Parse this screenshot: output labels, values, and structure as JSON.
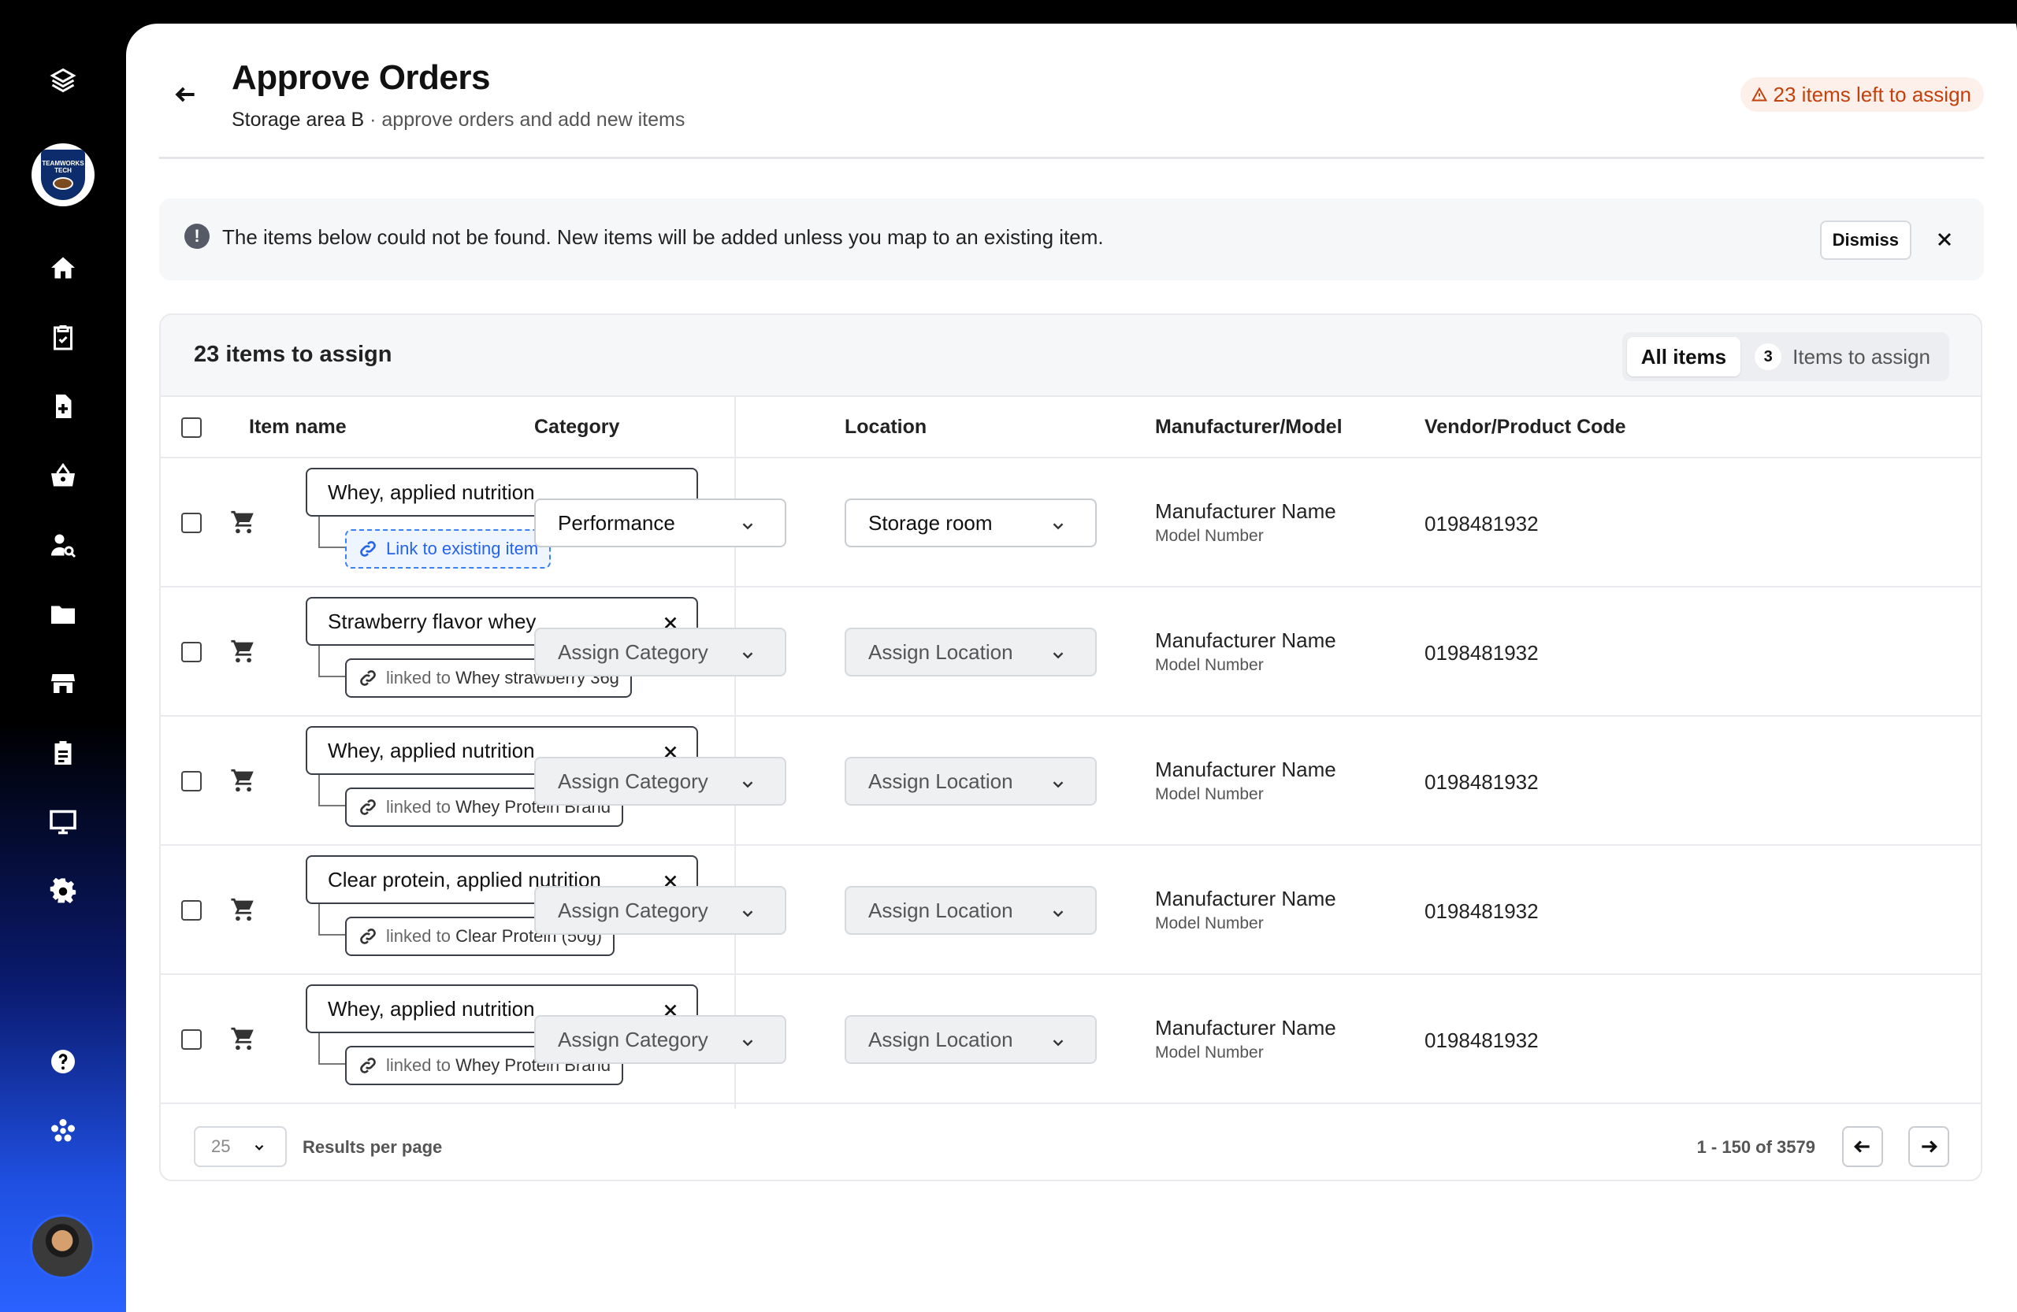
{
  "sidebar": {
    "icons": [
      "layers-logo-icon",
      "home-icon",
      "clipboard-check-icon",
      "file-add-icon",
      "basket-icon",
      "user-search-icon",
      "folder-icon",
      "store-icon",
      "clipboard-list-icon",
      "monitor-icon",
      "gear-icon",
      "help-icon",
      "apps-icon"
    ],
    "team_badge_text": "TEAMWORKS TECH"
  },
  "header": {
    "title": "Approve Orders",
    "subtitle_area": "Storage area B",
    "subtitle_sep": " · ",
    "subtitle_desc": "approve orders and add new items",
    "warning": "23 items left to assign"
  },
  "alert": {
    "message": "The items below could not be found. New items will be added unless you map to an existing item.",
    "dismiss_label": "Dismiss"
  },
  "card": {
    "title": "23 items to assign",
    "tabs": {
      "all_label": "All items",
      "assign_count": "3",
      "assign_label": "Items to assign"
    },
    "columns": {
      "item": "Item name",
      "category": "Category",
      "location": "Location",
      "manufacturer": "Manufacturer/Model",
      "vendor": "Vendor/Product Code"
    },
    "rows": [
      {
        "name": "Whey, applied nutrition",
        "link_prefix": "",
        "link_value": "Link to existing item",
        "category": "Performance",
        "location": "Storage room",
        "manufacturer": "Manufacturer Name",
        "model": "Model Number",
        "code": "0198481932"
      },
      {
        "name": "Strawberry flavor whey",
        "link_prefix": "linked to ",
        "link_value": "Whey strawberry 36g",
        "category": "Assign Category",
        "location": "Assign Location",
        "manufacturer": "Manufacturer Name",
        "model": "Model Number",
        "code": "0198481932"
      },
      {
        "name": "Whey, applied nutrition",
        "link_prefix": "linked to ",
        "link_value": "Whey Protein Brand",
        "category": "Assign Category",
        "location": "Assign Location",
        "manufacturer": "Manufacturer Name",
        "model": "Model Number",
        "code": "0198481932"
      },
      {
        "name": "Clear protein, applied nutrition",
        "link_prefix": "linked to ",
        "link_value": "Clear Protein (50g)",
        "category": "Assign Category",
        "location": "Assign Location",
        "manufacturer": "Manufacturer Name",
        "model": "Model Number",
        "code": "0198481932"
      },
      {
        "name": "Whey, applied nutrition",
        "link_prefix": "linked to ",
        "link_value": "Whey Protein Brand",
        "category": "Assign Category",
        "location": "Assign Location",
        "manufacturer": "Manufacturer Name",
        "model": "Model Number",
        "code": "0198481932"
      }
    ],
    "footer": {
      "per_page": "25",
      "per_page_label": "Results per page",
      "range": "1 - 150 of 3579"
    }
  }
}
